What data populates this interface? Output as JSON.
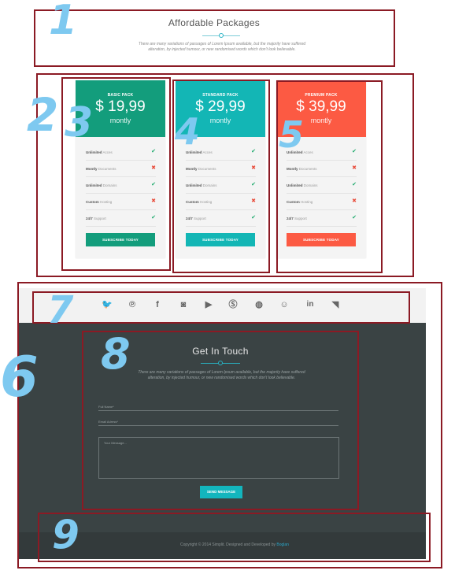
{
  "packages_section": {
    "title": "Affordable Packages",
    "subtitle_line1": "There are many variations of passages of Lorem Ipsum available, but the majority have suffered",
    "subtitle_line2": "alteration, by injected humour, or new randomised words which don't look believable."
  },
  "colors": {
    "annotation_box": "#8b1a24",
    "annotation_number": "#7ec9f0",
    "basic": "#139d7c",
    "standard": "#13b6b5",
    "premium": "#fc5a43",
    "dark_bg": "#3a4344",
    "accent": "#13b6be"
  },
  "annotations": [
    "1",
    "2",
    "3",
    "4",
    "5",
    "6",
    "7",
    "8",
    "9"
  ],
  "features": [
    {
      "bold": "Unlimited",
      "rest": " Acces"
    },
    {
      "bold": "Montly",
      "rest": " Documents"
    },
    {
      "bold": "Unlimited",
      "rest": " Domains"
    },
    {
      "bold": "Custom",
      "rest": " Hosting"
    },
    {
      "bold": "24/7",
      "rest": " Support"
    }
  ],
  "plans": [
    {
      "name": "BASIC PACK",
      "price": "$ 19,99",
      "period": "montly",
      "button": "SUBSCRIBE TODAY",
      "marks": [
        "check",
        "cross",
        "check",
        "cross",
        "check"
      ]
    },
    {
      "name": "STANDARD PACK",
      "price": "$ 29,99",
      "period": "montly",
      "button": "SUBSCRIBE TODAY",
      "marks": [
        "check",
        "cross",
        "check",
        "cross",
        "check"
      ]
    },
    {
      "name": "PREMIUM PACK",
      "price": "$ 39,99",
      "period": "montly",
      "button": "SUBSCRIBE TODAY",
      "marks": [
        "check",
        "cross",
        "check",
        "cross",
        "check"
      ]
    }
  ],
  "mark_glyphs": {
    "check": "✔",
    "cross": "✖"
  },
  "social_icons": [
    {
      "name": "twitter-icon",
      "glyph": "🐦"
    },
    {
      "name": "pinterest-icon",
      "glyph": "℗"
    },
    {
      "name": "facebook-icon",
      "glyph": "f"
    },
    {
      "name": "instagram-icon",
      "glyph": "◙"
    },
    {
      "name": "youtube-icon",
      "glyph": "▶"
    },
    {
      "name": "skype-icon",
      "glyph": "Ⓢ"
    },
    {
      "name": "dribbble-icon",
      "glyph": "◍"
    },
    {
      "name": "github-icon",
      "glyph": "☺"
    },
    {
      "name": "linkedin-icon",
      "glyph": "in"
    },
    {
      "name": "rss-icon",
      "glyph": "◥"
    }
  ],
  "contact": {
    "title": "Get In Touch",
    "subtitle_line1": "There are many variations of passages of Lorem Ipsum available, but the majority have suffered",
    "subtitle_line2": "alteration, by injected humour, or new randomised words which don't look believable.",
    "name_label": "Full Name*",
    "email_label": "Email Adress*",
    "message_placeholder": "Your Message...",
    "send_label": "SEND MESSAGE"
  },
  "footer": {
    "copyright": "Copyright © 2014 Simplit. Designed and Developed by ",
    "author": "Boglan"
  }
}
